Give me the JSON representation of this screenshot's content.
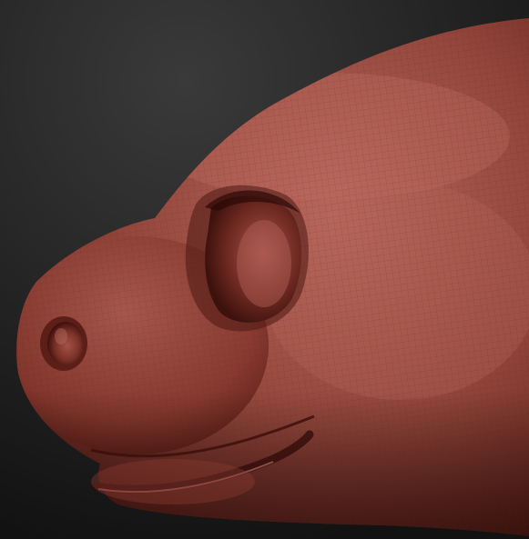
{
  "viewport": {
    "subject_icon": "sculpted-creature-head-icon",
    "colors": {
      "background_top": "#3a3a3a",
      "background_bottom": "#121212",
      "clay_light": "#b8675d",
      "clay_mid": "#93463b",
      "clay_dark": "#4a1713",
      "mesh_line": "#5a1f18"
    }
  }
}
